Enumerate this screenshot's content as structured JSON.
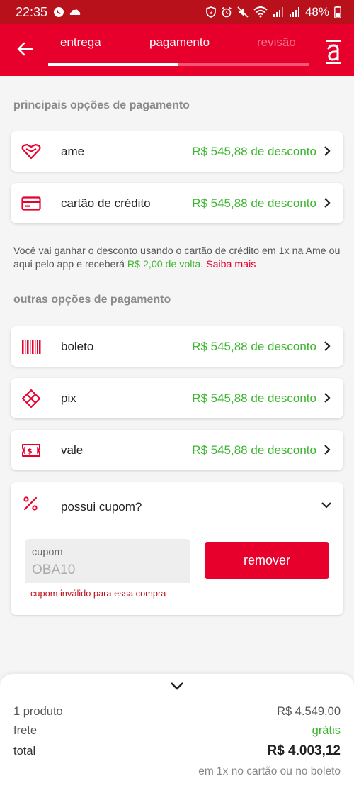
{
  "status_bar": {
    "time": "22:35",
    "battery": "48%"
  },
  "header": {
    "steps": [
      {
        "label": "entrega"
      },
      {
        "label": "pagamento"
      },
      {
        "label": "revisão"
      }
    ],
    "progress_fraction": 0.5,
    "brand_icon": "americanas-a-logo",
    "back_icon": "arrow-left-icon"
  },
  "main_options": {
    "title": "principais opções de pagamento",
    "items": [
      {
        "label": "ame",
        "discount": "R$ 545,88 de desconto",
        "icon": "ame-heart-icon"
      },
      {
        "label": "cartão de crédito",
        "discount": "R$ 545,88 de desconto",
        "icon": "credit-card-icon"
      }
    ]
  },
  "note": {
    "text": "Você vai ganhar o desconto usando o cartão de crédito em 1x na Ame ou aqui pelo app e receberá ",
    "cashback": "R$ 2,00 de volta",
    "separator": ". ",
    "link": "Saiba mais"
  },
  "other_options": {
    "title": "outras opções de pagamento",
    "items": [
      {
        "label": "boleto",
        "discount": "R$ 545,88 de desconto",
        "icon": "barcode-icon"
      },
      {
        "label": "pix",
        "discount": "R$ 545,88 de desconto",
        "icon": "pix-icon"
      },
      {
        "label": "vale",
        "discount": "R$ 545,88 de desconto",
        "icon": "voucher-icon"
      }
    ]
  },
  "coupon": {
    "title": "possui cupom?",
    "field_label": "cupom",
    "field_value": "OBA10",
    "remove_label": "remover",
    "error": "cupom inválido para essa compra"
  },
  "summary": {
    "products_label": "1 produto",
    "products_value": "R$ 4.549,00",
    "shipping_label": "frete",
    "shipping_value": "grátis",
    "total_label": "total",
    "total_value": "R$ 4.003,12",
    "payment_note": "em 1x no cartão ou no boleto"
  },
  "colors": {
    "brand_red": "#e8002d",
    "status_red": "#b8111c",
    "discount_green": "#3cb52f"
  }
}
